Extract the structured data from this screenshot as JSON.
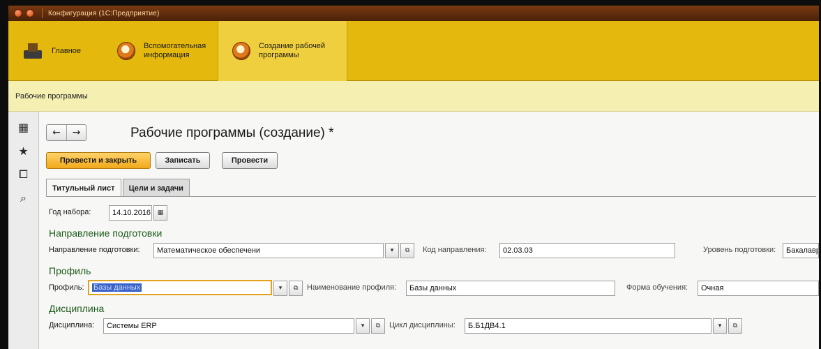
{
  "window": {
    "title": "Конфигурация (1С:Предприятие)"
  },
  "sections": [
    {
      "label": "Главное",
      "icon": "home-icon"
    },
    {
      "label": "Вспомогательная\nинформация",
      "icon": "circle-icon"
    },
    {
      "label": "Создание рабочей\nпрограммы",
      "icon": "circle-icon"
    }
  ],
  "breadcrumb": "Рабочие программы",
  "left_toolbar": [
    "grid-icon",
    "star-icon",
    "history-icon",
    "search-icon"
  ],
  "page": {
    "title": "Рабочие программы (создание) *"
  },
  "nav": {
    "back": "←",
    "forward": "→"
  },
  "buttons": {
    "post_close": "Провести и закрыть",
    "save": "Записать",
    "post": "Провести"
  },
  "tabs": [
    "Титульный лист",
    "Цели и задачи"
  ],
  "year": {
    "label": "Год набора:",
    "value": "14.10.2016"
  },
  "direction": {
    "group_title": "Направление подготовки",
    "label": "Направление подготовки:",
    "value": "Математическое обеспечени",
    "code_label": "Код направления:",
    "code_value": "02.03.03",
    "level_label": "Уровень подготовки:",
    "level_value": "Бакалавр"
  },
  "profile": {
    "group_title": "Профиль",
    "label": "Профиль:",
    "value": "Базы данных",
    "name_label": "Наименование профиля:",
    "name_value": "Базы данных",
    "form_label": "Форма обучения:",
    "form_value": "Очная"
  },
  "discipline": {
    "group_title": "Дисциплина",
    "label": "Дисциплина:",
    "value": "Системы ERP",
    "cycle_label": "Цикл дисциплины:",
    "cycle_value": "Б.Б1ДВ4.1"
  },
  "glyphs": {
    "dropdown": "▾",
    "open": "⧉",
    "calendar": "▦"
  },
  "colors": {
    "sections_bg": "#e5b80e",
    "group_title": "#1c5a1c",
    "primary_button": "#f1a81a",
    "selection": "#3a62c8"
  }
}
